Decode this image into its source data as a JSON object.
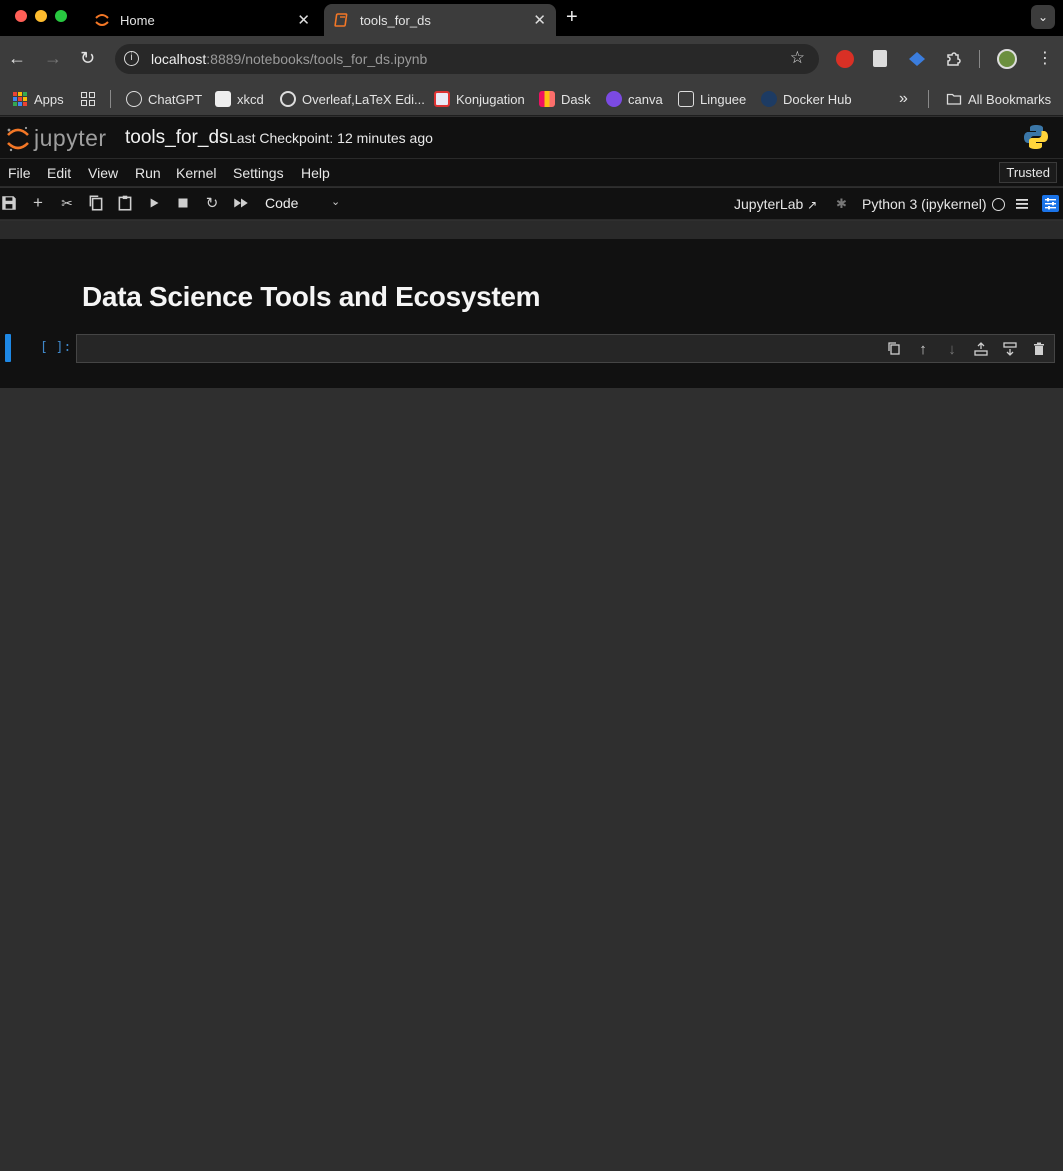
{
  "browser": {
    "tabs": [
      {
        "title": "Home",
        "active": false
      },
      {
        "title": "tools_for_ds",
        "active": true
      }
    ],
    "url_host": "localhost",
    "url_rest": ":8889/notebooks/tools_for_ds.ipynb",
    "bookmarks": [
      "Apps",
      "ChatGPT",
      "xkcd",
      "Overleaf,LaTeX Edi...",
      "Konjugation",
      "Dask",
      "canva",
      "Linguee",
      "Docker Hub"
    ],
    "all_bookmarks": "All Bookmarks",
    "overflow_glyph": "»"
  },
  "jupyter": {
    "wordmark": "jupyter",
    "notebook_title": "tools_for_ds",
    "checkpoint": "Last Checkpoint: 12 minutes ago",
    "menu": [
      "File",
      "Edit",
      "View",
      "Run",
      "Kernel",
      "Settings",
      "Help"
    ],
    "trusted": "Trusted",
    "cell_type": "Code",
    "jupyterlab_link": "JupyterLab",
    "kernel": "Python 3 (ipykernel)",
    "accent": "#1e88e5"
  },
  "notebook": {
    "heading": "Data Science Tools and Ecosystem",
    "prompt": "[ ]:",
    "cell_source": ""
  }
}
